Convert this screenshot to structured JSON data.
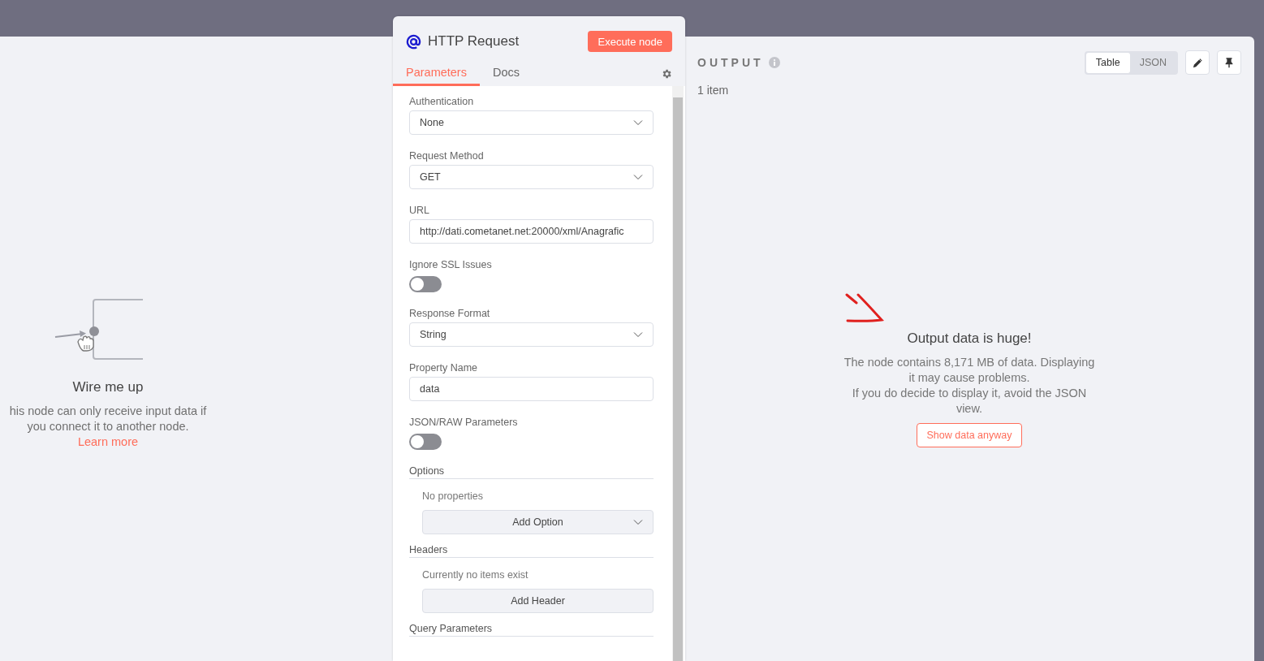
{
  "input_panel": {
    "title": "Wire me up",
    "message": "his node can only receive input data if you connect it to another node.",
    "link": "Learn more"
  },
  "node": {
    "title": "HTTP Request",
    "execute_button": "Execute node",
    "tabs": [
      {
        "label": "Parameters",
        "selected": true
      },
      {
        "label": "Docs",
        "selected": false
      }
    ],
    "parameters": [
      {
        "kind": "select",
        "label": "Authentication",
        "value": "None"
      },
      {
        "kind": "select",
        "label": "Request Method",
        "value": "GET"
      },
      {
        "kind": "input",
        "label": "URL",
        "value": "http://dati.cometanet.net:20000/xml/Anagrafic"
      },
      {
        "kind": "toggle",
        "label": "Ignore SSL Issues",
        "on": false
      },
      {
        "kind": "select",
        "label": "Response Format",
        "value": "String"
      },
      {
        "kind": "input",
        "label": "Property Name",
        "value": "data"
      },
      {
        "kind": "toggle",
        "label": "JSON/RAW Parameters",
        "on": false
      },
      {
        "kind": "collection",
        "label": "Options",
        "empty_text": "No properties",
        "button": "Add Option",
        "dropdown": true
      },
      {
        "kind": "collection",
        "label": "Headers",
        "empty_text": "Currently no items exist",
        "button": "Add Header",
        "dropdown": false
      },
      {
        "kind": "heading",
        "label": "Query Parameters"
      }
    ]
  },
  "output": {
    "title": "OUTPUT",
    "item_count": "1 item",
    "view_modes": [
      {
        "label": "Table",
        "selected": true
      },
      {
        "label": "JSON",
        "selected": false
      }
    ],
    "warning": {
      "title": "Output data is huge!",
      "paragraphs": [
        "The node contains 8,171 MB of data. Displaying it may cause problems.",
        "If you do decide to display it, avoid the JSON view."
      ],
      "button": "Show data anyway"
    }
  }
}
